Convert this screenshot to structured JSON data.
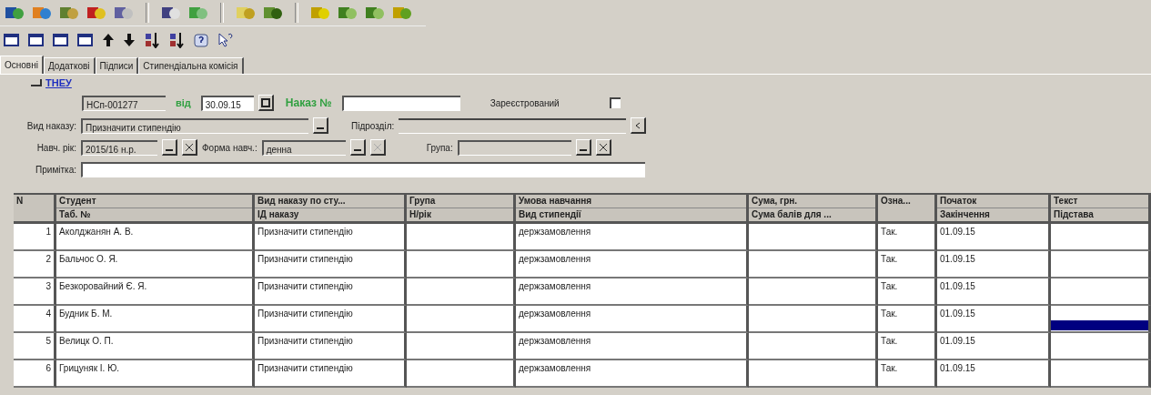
{
  "tabs": [
    {
      "label": "Основні",
      "selected": true
    },
    {
      "label": "Додаткові",
      "selected": false
    },
    {
      "label": "Підписи",
      "selected": false
    },
    {
      "label": "Стипендіальна комісія",
      "selected": false
    }
  ],
  "org_link": "ТНЕУ",
  "order": {
    "number": "НСп-001277",
    "date_label": "від",
    "date": "30.09.15",
    "order_no_label": "Наказ №",
    "registered_label": "Зареєстрований",
    "registered": false,
    "type_label": "Вид наказу:",
    "type": "Призначити стипендію",
    "unit_label": "Підрозділ:",
    "year_label": "Навч. рік:",
    "year": "2015/16 н.р.",
    "form_label": "Форма навч.:",
    "form": "денна",
    "group_label": "Група:",
    "note_label": "Примітка:"
  },
  "table": {
    "columns": [
      {
        "top": "N"
      },
      {
        "top": "Студент",
        "bottom": "Таб. №"
      },
      {
        "top": "Вид наказу по сту...",
        "bottom": "ІД наказу"
      },
      {
        "top": "Група",
        "bottom": "Н/рік"
      },
      {
        "top": "Умова навчання",
        "bottom": "Вид стипендії"
      },
      {
        "top": "Сума, грн.",
        "bottom": "Сума балів для ..."
      },
      {
        "top": "Озна..."
      },
      {
        "top": "Початок",
        "bottom": "Закінчення"
      },
      {
        "top": "Текст",
        "bottom": "Підстава"
      }
    ],
    "rows": [
      {
        "n": "1",
        "student": "Аколджанян А. В.",
        "type": "Призначити стипендію",
        "condition": "держзамовлення",
        "flag": "Так.",
        "start": "01.09.15",
        "selected": false
      },
      {
        "n": "2",
        "student": "Бальчос О. Я.",
        "type": "Призначити стипендію",
        "condition": "держзамовлення",
        "flag": "Так.",
        "start": "01.09.15",
        "selected": false
      },
      {
        "n": "3",
        "student": "Безкоровайний Є. Я.",
        "type": "Призначити стипендію",
        "condition": "держзамовлення",
        "flag": "Так.",
        "start": "01.09.15",
        "selected": false
      },
      {
        "n": "4",
        "student": "Будник Б. М.",
        "type": "Призначити стипендію",
        "condition": "держзамовлення",
        "flag": "Так.",
        "start": "01.09.15",
        "selected": true
      },
      {
        "n": "5",
        "student": "Велицк О. П.",
        "type": "Призначити стипендію",
        "condition": "держзамовлення",
        "flag": "Так.",
        "start": "01.09.15",
        "selected": false
      },
      {
        "n": "6",
        "student": "Грицуняк І. Ю.",
        "type": "Призначити стипендію",
        "condition": "держзамовлення",
        "flag": "Так.",
        "start": "01.09.15",
        "selected": false
      }
    ]
  }
}
